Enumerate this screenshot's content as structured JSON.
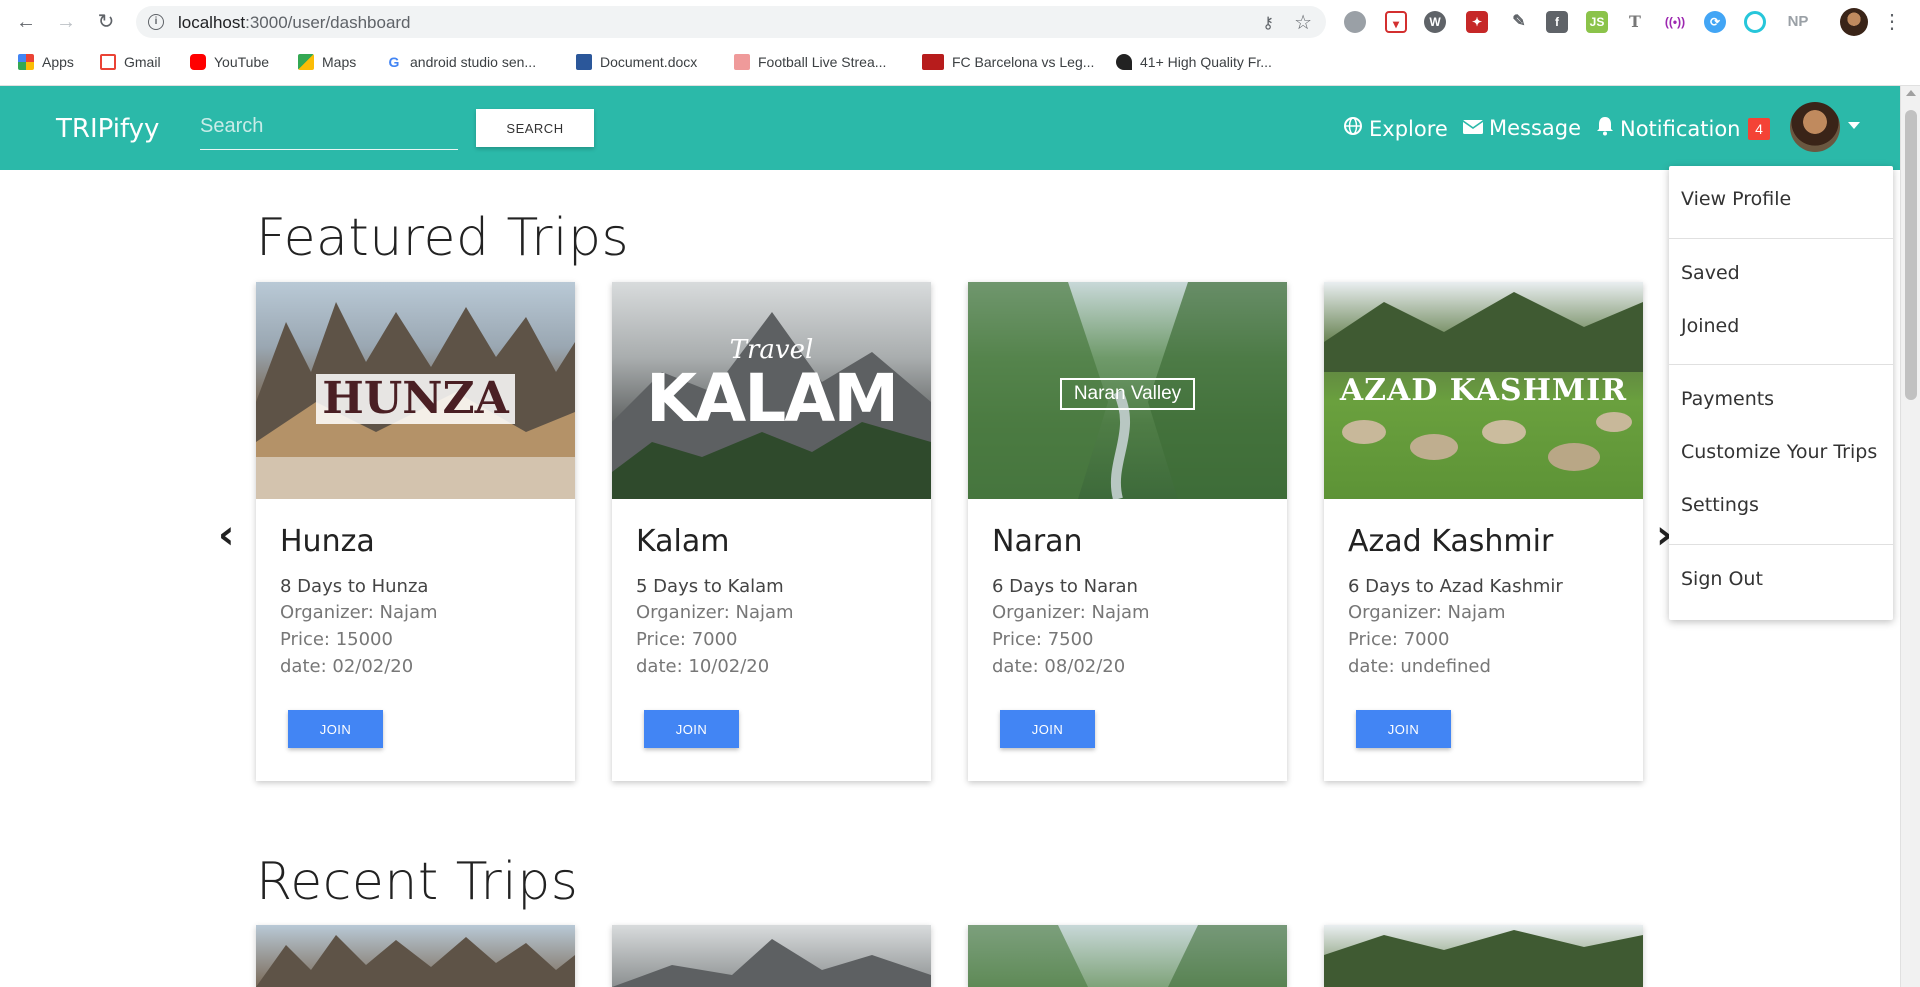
{
  "browser": {
    "url_host": "localhost",
    "url_path": ":3000/user/dashboard",
    "bookmarks": [
      {
        "label": "Apps",
        "icon": "apps-grid-icon",
        "color": "#ea4335"
      },
      {
        "label": "Gmail",
        "icon": "gmail-icon",
        "color": "#ea4335"
      },
      {
        "label": "YouTube",
        "icon": "youtube-icon",
        "color": "#ff0000"
      },
      {
        "label": "Maps",
        "icon": "maps-icon",
        "color": "#34a853"
      },
      {
        "label": "android studio sen...",
        "icon": "google-icon",
        "color": "#4285f4"
      },
      {
        "label": "Document.docx",
        "icon": "word-icon",
        "color": "#2b579a"
      },
      {
        "label": "Football Live Strea...",
        "icon": "football-icon",
        "color": "#d44"
      },
      {
        "label": "FC Barcelona vs Leg...",
        "icon": "ts-icon",
        "color": "#b71c1c"
      },
      {
        "label": "41+ High Quality Fr...",
        "icon": "horse-icon",
        "color": "#222222"
      }
    ],
    "extension_np": "NP",
    "extension_t": "T"
  },
  "navbar": {
    "brand": "TRIPifyy",
    "search_placeholder": "Search",
    "search_button": "SEARCH",
    "explore": "Explore",
    "message": "Message",
    "notification": "Notification",
    "notification_count": "4",
    "accent_color": "#2bb9a9"
  },
  "featured": {
    "title": "Featured Trips",
    "cards": [
      {
        "image_text": "HUNZA",
        "name": "Hunza",
        "subtitle": "8 Days to Hunza",
        "organizer": "Organizer: Najam",
        "price": "Price: 15000",
        "date": "date: 02/02/20",
        "join": "JOIN"
      },
      {
        "image_text_small": "Travel",
        "image_text": "KALAM",
        "name": "Kalam",
        "subtitle": "5 Days to Kalam",
        "organizer": "Organizer: Najam",
        "price": "Price: 7000",
        "date": "date: 10/02/20",
        "join": "JOIN"
      },
      {
        "image_text": "Naran Valley",
        "name": "Naran",
        "subtitle": "6 Days to Naran",
        "organizer": "Organizer: Najam",
        "price": "Price: 7500",
        "date": "date: 08/02/20",
        "join": "JOIN"
      },
      {
        "image_text": "AZAD KASHMIR",
        "name": "Azad Kashmir",
        "subtitle": "6 Days to Azad Kashmir",
        "organizer": "Organizer: Najam",
        "price": "Price: 7000",
        "date": "date: undefined",
        "join": "JOIN"
      }
    ],
    "join_color": "#4285f4"
  },
  "recent": {
    "title": "Recent Trips"
  },
  "dropdown": {
    "items": [
      "View Profile",
      "Saved",
      "Joined",
      "Payments",
      "Customize Your Trips",
      "Settings",
      "Sign Out"
    ]
  }
}
